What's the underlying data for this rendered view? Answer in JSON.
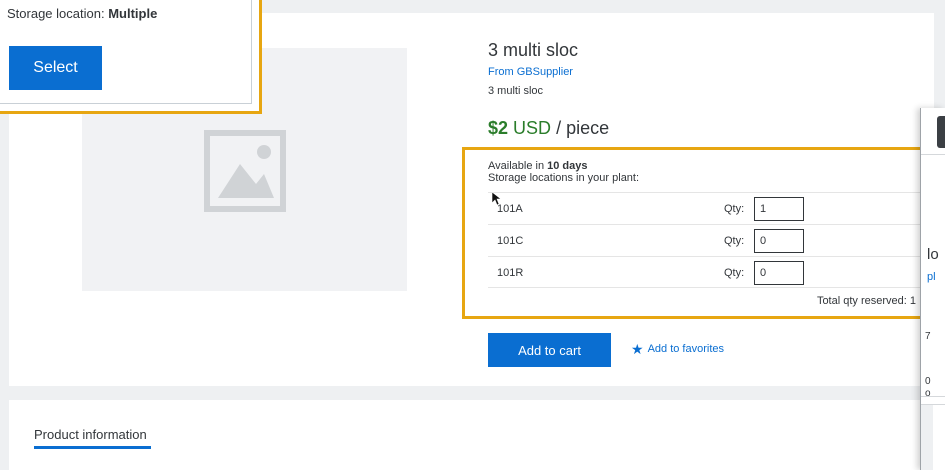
{
  "popup": {
    "storage_label": "Storage location:",
    "storage_value": "Multiple",
    "select_label": "Select"
  },
  "product": {
    "title": "3 multi sloc",
    "supplier": "From GBSupplier",
    "description": "3 multi sloc",
    "price_amount": "$2",
    "price_currency": "USD",
    "price_unit": "/ piece"
  },
  "storage": {
    "availability_prefix": "Available in",
    "availability_value": "10 days",
    "heading": "Storage locations in your plant:",
    "qty_label": "Qty:",
    "rows": [
      {
        "code": "101A",
        "qty": "1"
      },
      {
        "code": "101C",
        "qty": "0"
      },
      {
        "code": "101R",
        "qty": "0"
      }
    ],
    "total": "Total qty reserved: 1"
  },
  "actions": {
    "add_to_cart": "Add to cart",
    "add_to_favorites": "Add to favorites"
  },
  "info": {
    "tab_label": "Product information"
  },
  "right_window": {
    "text_lo": "lo",
    "text_pl": "pl",
    "text_7": "7",
    "text_0": "0",
    "text_o": "o"
  },
  "colors": {
    "accent": "#0a6ed1",
    "highlight": "#e7a611",
    "price": "#2b7d2b"
  },
  "icons": {
    "image_placeholder": "image-placeholder-icon",
    "favorites": "star-icon",
    "cursor": "mouse-pointer-icon"
  }
}
